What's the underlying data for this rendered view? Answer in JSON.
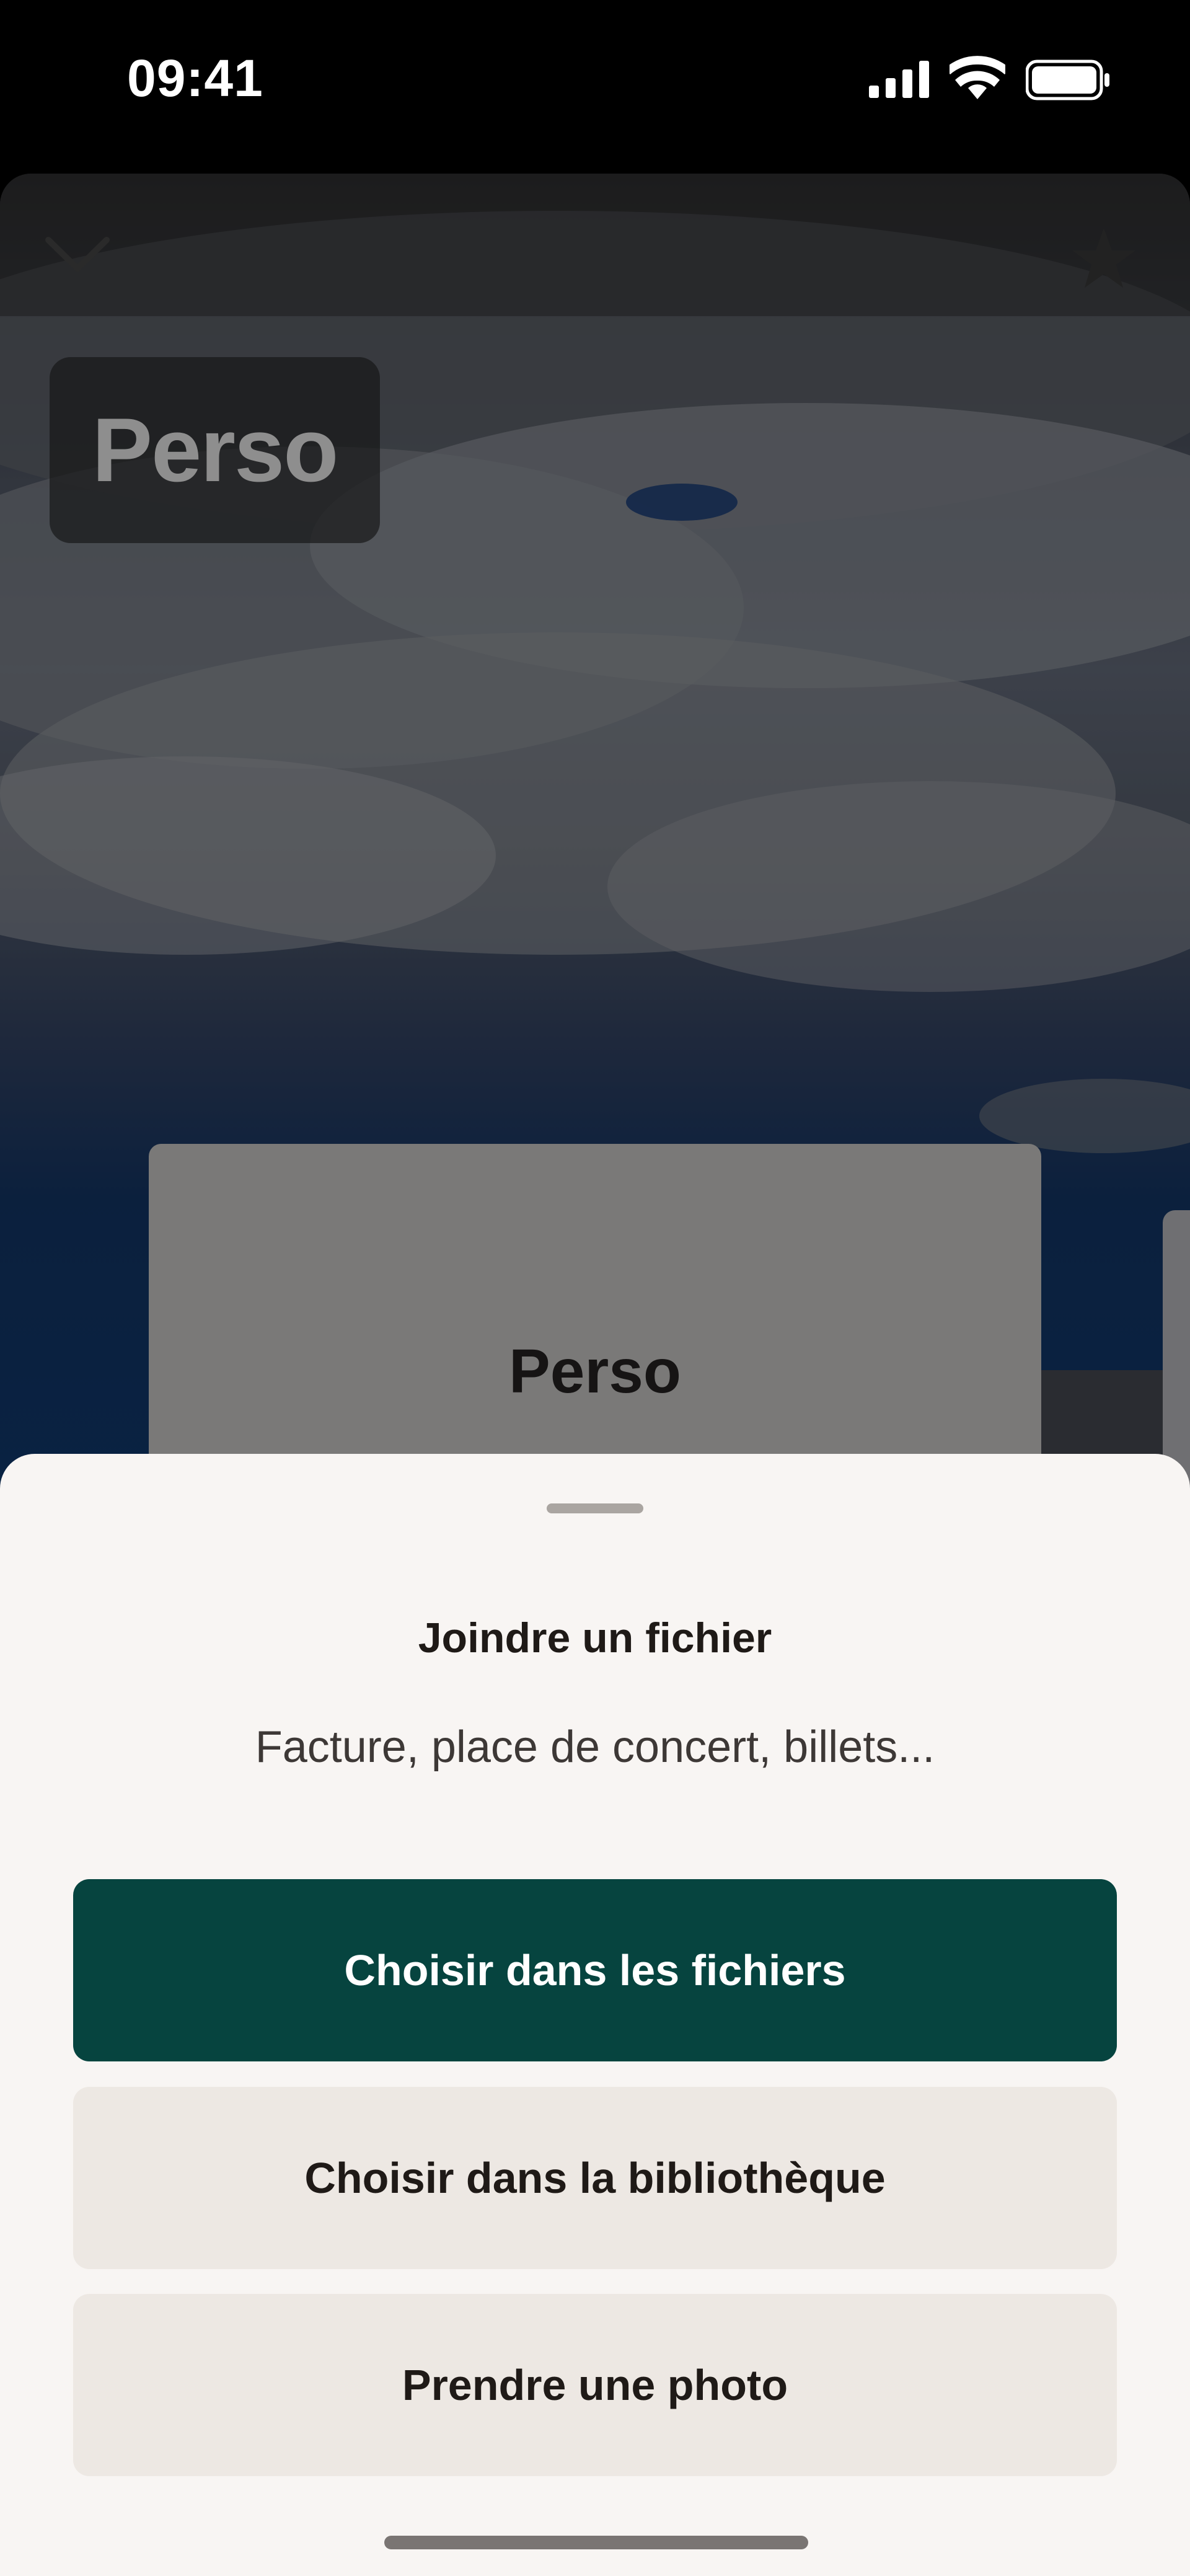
{
  "status_bar": {
    "time": "09:41",
    "icons": [
      "cellular-signal-icon",
      "wifi-icon",
      "battery-icon"
    ]
  },
  "note": {
    "header_icons": [
      "chevron-down-icon",
      "star-icon"
    ],
    "title": "Perso",
    "card_title": "Perso"
  },
  "sheet": {
    "title": "Joindre un fichier",
    "subtitle": "Facture, place de concert, billets...",
    "buttons": {
      "files": "Choisir dans les fichiers",
      "library": "Choisir dans la bibliothèque",
      "photo": "Prendre une photo"
    }
  },
  "colors": {
    "primary": "#06443f",
    "sheet_background": "#f8f5f3",
    "secondary_button": "#ede8e3",
    "text_dark": "#1f1a17"
  }
}
